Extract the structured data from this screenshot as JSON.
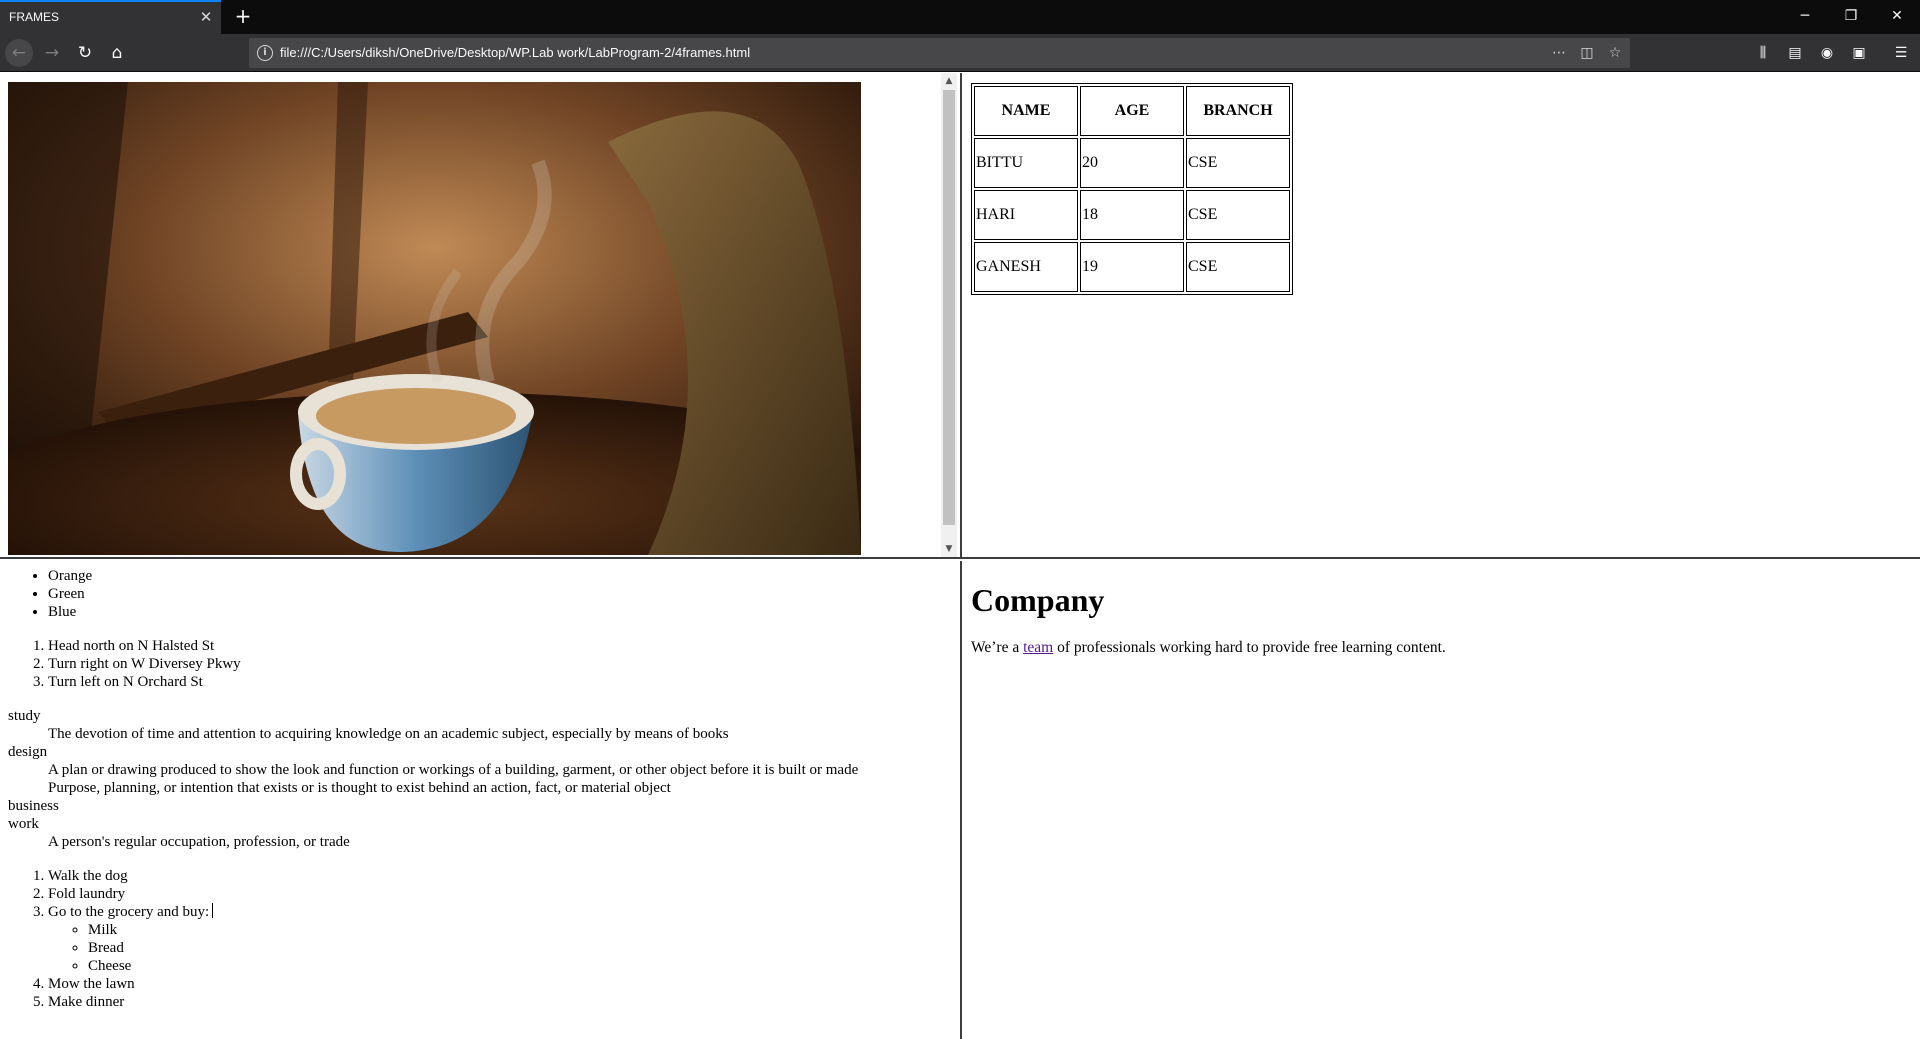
{
  "browser": {
    "tab_title": "FRAMES",
    "url": "file:///C:/Users/diksh/OneDrive/Desktop/WP.Lab work/LabProgram-2/4frames.html",
    "accent_color": "#0a84ff"
  },
  "table": {
    "headers": [
      "NAME",
      "AGE",
      "BRANCH"
    ],
    "rows": [
      [
        "BITTU",
        "20",
        "CSE"
      ],
      [
        "HARI",
        "18",
        "CSE"
      ],
      [
        "GANESH",
        "19",
        "CSE"
      ]
    ]
  },
  "lists": {
    "colors": [
      "Orange",
      "Green",
      "Blue"
    ],
    "directions": [
      "Head north on N Halsted St",
      "Turn right on W Diversey Pkwy",
      "Turn left on N Orchard St"
    ],
    "definitions": [
      {
        "term": "study",
        "def": "The devotion of time and attention to acquiring knowledge on an academic subject, especially by means of books"
      },
      {
        "term": "design",
        "def": "A plan or drawing produced to show the look and function or workings of a building, garment, or other object before it is built or made"
      },
      {
        "def": "Purpose, planning, or intention that exists or is thought to exist behind an action, fact, or material object"
      },
      {
        "term": "business"
      },
      {
        "term": "work",
        "def": "A person's regular occupation, profession, or trade"
      }
    ],
    "todo": [
      "Walk the dog",
      "Fold laundry",
      "Go to the grocery and buy:",
      "Mow the lawn",
      "Make dinner"
    ],
    "grocery": [
      "Milk",
      "Bread",
      "Cheese"
    ]
  },
  "company": {
    "heading": "Company",
    "text_before": "We’re a ",
    "link_text": "team",
    "text_after": " of professionals working hard to provide free learning content."
  }
}
